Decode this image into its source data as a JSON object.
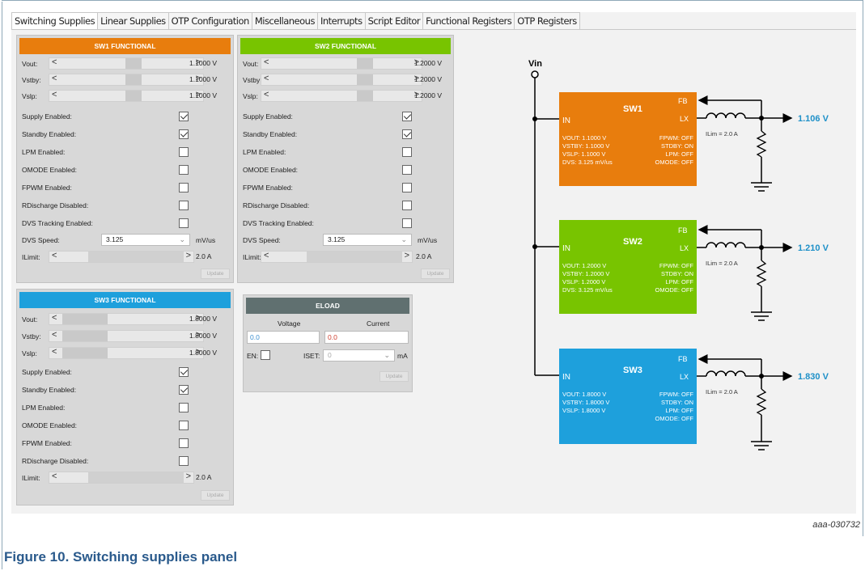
{
  "tabs": [
    "Switching Supplies",
    "Linear Supplies",
    "OTP Configuration",
    "Miscellaneous",
    "Interrupts",
    "Script Editor",
    "Functional Registers",
    "OTP Registers"
  ],
  "colors": {
    "sw1": "#e87d0d",
    "sw2": "#78c400",
    "sw3": "#1ea0dc",
    "eload": "#607070",
    "output_text": "#1e90c8"
  },
  "sw1": {
    "title": "SW1 FUNCTIONAL",
    "vout_label": "Vout:",
    "vout_value": "1.1000 V",
    "vstby_label": "Vstby:",
    "vstby_value": "1.1000 V",
    "vslp_label": "Vslp:",
    "vslp_value": "1.1000 V",
    "supply_enabled_label": "Supply Enabled:",
    "supply_enabled": true,
    "standby_enabled_label": "Standby Enabled:",
    "standby_enabled": true,
    "lpm_enabled_label": "LPM Enabled:",
    "lpm_enabled": false,
    "omode_enabled_label": "OMODE Enabled:",
    "omode_enabled": false,
    "fpwm_enabled_label": "FPWM Enabled:",
    "fpwm_enabled": false,
    "rdischarge_label": "RDischarge Disabled:",
    "rdischarge": false,
    "dvs_tracking_label": "DVS Tracking Enabled:",
    "dvs_tracking": false,
    "dvs_speed_label": "DVS Speed:",
    "dvs_speed_value": "3.125",
    "dvs_speed_unit": "mV/us",
    "ilimit_label": "ILimit:",
    "ilimit_value": "2.0 A",
    "update_label": "Update"
  },
  "sw2": {
    "title": "SW2 FUNCTIONAL",
    "vout_label": "Vout:",
    "vout_value": "1.2000 V",
    "vstby_label": "Vstby:",
    "vstby_value": "1.2000 V",
    "vslp_label": "Vslp:",
    "vslp_value": "1.2000 V",
    "supply_enabled_label": "Supply Enabled:",
    "supply_enabled": true,
    "standby_enabled_label": "Standby Enabled:",
    "standby_enabled": true,
    "lpm_enabled_label": "LPM Enabled:",
    "lpm_enabled": false,
    "omode_enabled_label": "OMODE Enabled:",
    "omode_enabled": false,
    "fpwm_enabled_label": "FPWM Enabled:",
    "fpwm_enabled": false,
    "rdischarge_label": "RDischarge Disabled:",
    "rdischarge": false,
    "dvs_tracking_label": "DVS Tracking Enabled:",
    "dvs_tracking": false,
    "dvs_speed_label": "DVS Speed:",
    "dvs_speed_value": "3.125",
    "dvs_speed_unit": "mV/us",
    "ilimit_label": "ILimit:",
    "ilimit_value": "2.0 A",
    "update_label": "Update"
  },
  "sw3": {
    "title": "SW3 FUNCTIONAL",
    "vout_label": "Vout:",
    "vout_value": "1.8000 V",
    "vstby_label": "Vstby:",
    "vstby_value": "1.8000 V",
    "vslp_label": "Vslp:",
    "vslp_value": "1.8000 V",
    "supply_enabled_label": "Supply Enabled:",
    "supply_enabled": true,
    "standby_enabled_label": "Standby Enabled:",
    "standby_enabled": true,
    "lpm_enabled_label": "LPM Enabled:",
    "lpm_enabled": false,
    "omode_enabled_label": "OMODE Enabled:",
    "omode_enabled": false,
    "fpwm_enabled_label": "FPWM Enabled:",
    "fpwm_enabled": false,
    "rdischarge_label": "RDischarge Disabled:",
    "rdischarge": false,
    "ilimit_label": "ILimit:",
    "ilimit_value": "2.0 A",
    "update_label": "Update"
  },
  "eload": {
    "title": "ELOAD",
    "voltage_label": "Voltage",
    "current_label": "Current",
    "voltage_value": "0.0",
    "current_value": "0.0",
    "en_label": "EN:",
    "en": false,
    "iset_label": "ISET:",
    "iset_value": "0",
    "iset_unit": "mA",
    "update_label": "Update"
  },
  "diagram": {
    "vin_label": "Vin",
    "blocks": [
      {
        "name": "SW1",
        "in": "IN",
        "fb": "FB",
        "lx": "LX",
        "left": [
          "VOUT: 1.1000 V",
          "VSTBY: 1.1000 V",
          "VSLP: 1.1000 V",
          "DVS: 3.125 mV/us"
        ],
        "right": [
          "FPWM: OFF",
          "STDBY: ON",
          "LPM: OFF",
          "OMODE: OFF"
        ],
        "ilim": "ILim = 2.0 A",
        "output": "1.106 V"
      },
      {
        "name": "SW2",
        "in": "IN",
        "fb": "FB",
        "lx": "LX",
        "left": [
          "VOUT: 1.2000 V",
          "VSTBY: 1.2000 V",
          "VSLP: 1.2000 V",
          "DVS: 3.125 mV/us"
        ],
        "right": [
          "FPWM: OFF",
          "STDBY: ON",
          "LPM: OFF",
          "OMODE: OFF"
        ],
        "ilim": "ILim = 2.0 A",
        "output": "1.210 V"
      },
      {
        "name": "SW3",
        "in": "IN",
        "fb": "FB",
        "lx": "LX",
        "left": [
          "VOUT: 1.8000 V",
          "VSTBY: 1.8000 V",
          "VSLP: 1.8000 V"
        ],
        "right": [
          "FPWM: OFF",
          "STDBY: ON",
          "LPM: OFF",
          "OMODE: OFF"
        ],
        "ilim": "ILim = 2.0 A",
        "output": "1.830 V"
      }
    ]
  },
  "figure_code": "aaa-030732",
  "figure_caption": "Figure 10.  Switching supplies panel"
}
